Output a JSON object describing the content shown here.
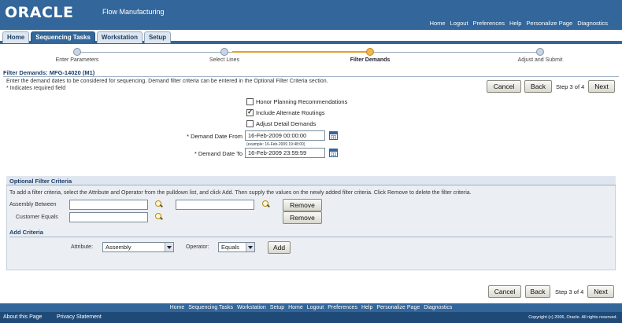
{
  "header": {
    "brand": "ORACLE",
    "app_title": "Flow Manufacturing",
    "global_links": [
      "Home",
      "Logout",
      "Preferences",
      "Help",
      "Personalize Page",
      "Diagnostics"
    ]
  },
  "tabs": [
    {
      "label": "Home",
      "active": false
    },
    {
      "label": "Sequencing Tasks",
      "active": true
    },
    {
      "label": "Workstation",
      "active": false
    },
    {
      "label": "Setup",
      "active": false
    }
  ],
  "train": [
    {
      "label": "Enter Parameters",
      "current": false
    },
    {
      "label": "Select Lines",
      "current": false
    },
    {
      "label": "Filter Demands",
      "current": true
    },
    {
      "label": "Adjust and Submit",
      "current": false
    }
  ],
  "page": {
    "title": "Filter Demands: MFG-14020 (M1)",
    "instructions": "Enter the demand dates to be considered for sequencing. Demand filter criteria can be entered in the Optional Filter Criteria section.",
    "required_note": "Indicates required field",
    "required_star": "*"
  },
  "nav": {
    "cancel": "Cancel",
    "back": "Back",
    "step": "Step 3 of 4",
    "next": "Next"
  },
  "options": {
    "honor_planning": {
      "label": "Honor Planning Recommendations",
      "checked": false
    },
    "include_alternate": {
      "label": "Include Alternate Routings",
      "checked": true
    },
    "adjust_detail": {
      "label": "Adjust Detail Demands",
      "checked": false
    }
  },
  "dates": {
    "from_label": "Demand Date From",
    "from_value": "16-Feb-2009 00:00:00",
    "example": "(example: 16-Feb-2009 19:48:00)",
    "to_label": "Demand Date To",
    "to_value": "16-Feb-2009 23:59:59"
  },
  "optional": {
    "header": "Optional Filter Criteria",
    "instructions": "To add a filter criteria, select the Attribute and Operator from the pulldown list, and click Add. Then supply the values on the newly added filter criteria. Click Remove to delete the filter criteria.",
    "assembly_between_label": "Assembly Between",
    "customer_equals_label": "Customer Equals",
    "remove_label": "Remove",
    "add_criteria_header": "Add Criteria",
    "attribute_label": "Attribute",
    "attribute_value": "Assembly",
    "operator_label": "Operator",
    "operator_value": "Equals",
    "add_label": "Add"
  },
  "footer": {
    "links": [
      "Home",
      "Sequencing Tasks",
      "Workstation",
      "Setup",
      "Home",
      "Logout",
      "Preferences",
      "Help",
      "Personalize Page",
      "Diagnostics"
    ],
    "about": "About this Page",
    "privacy": "Privacy Statement",
    "copyright": "Copyright (c) 2006, Oracle. All rights reserved."
  }
}
